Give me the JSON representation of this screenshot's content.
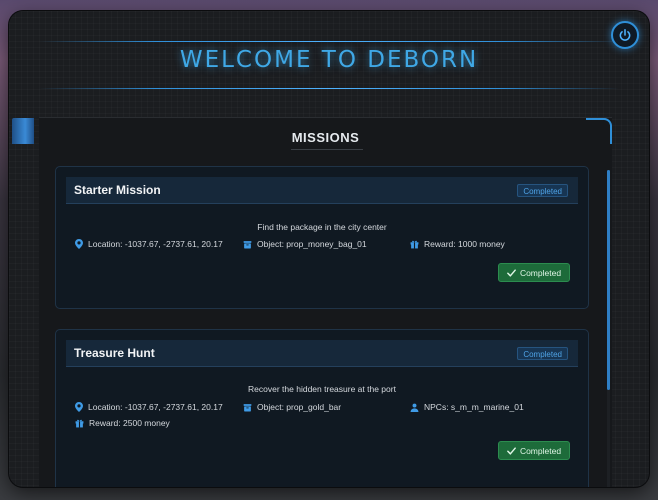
{
  "header": {
    "title": "WELCOME TO DEBORN"
  },
  "panel": {
    "heading": "MISSIONS"
  },
  "missions": [
    {
      "title": "Starter Mission",
      "status": "Completed",
      "description": "Find the package in the city center",
      "location": "Location: -1037.67, -2737.61, 20.17",
      "object": "Object: prop_money_bag_01",
      "reward": "Reward: 1000 money",
      "button_label": "Completed"
    },
    {
      "title": "Treasure Hunt",
      "status": "Completed",
      "description": "Recover the hidden treasure at the port",
      "location": "Location: -1037.67, -2737.61, 20.17",
      "object": "Object: prop_gold_bar",
      "npcs": "NPCs: s_m_m_marine_01",
      "reward": "Reward: 2500 money",
      "button_label": "Completed"
    }
  ],
  "colors": {
    "accent": "#2f8fd8",
    "title": "#3fa8e6",
    "success": "#1d6b3a"
  },
  "icons": [
    "power-icon",
    "map-pin-icon",
    "box-icon",
    "gift-icon",
    "user-icon",
    "check-icon"
  ]
}
